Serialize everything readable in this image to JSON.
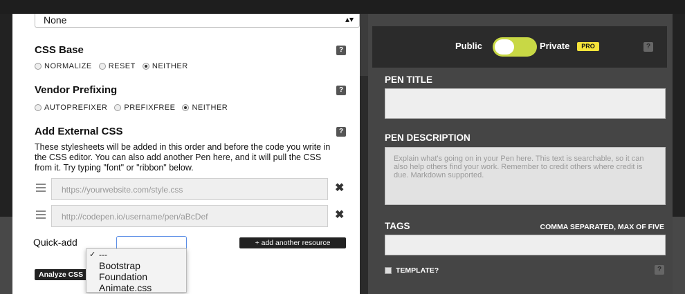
{
  "top_select": {
    "value": "None",
    "arrows": "▴▾"
  },
  "css_base": {
    "title": "CSS Base",
    "help": "?",
    "options": [
      {
        "label": "NORMALIZE",
        "checked": false
      },
      {
        "label": "RESET",
        "checked": false
      },
      {
        "label": "NEITHER",
        "checked": true
      }
    ]
  },
  "vendor_prefixing": {
    "title": "Vendor Prefixing",
    "help": "?",
    "options": [
      {
        "label": "AUTOPREFIXER",
        "checked": false
      },
      {
        "label": "PREFIXFREE",
        "checked": false
      },
      {
        "label": "NEITHER",
        "checked": true
      }
    ]
  },
  "external_css": {
    "title": "Add External CSS",
    "help": "?",
    "description": "These stylesheets will be added in this order and before the code you write in the CSS editor. You can also add another Pen here, and it will pull the CSS from it. Try typing \"font\" or \"ribbon\" below.",
    "resources": [
      {
        "placeholder": "https://yourwebsite.com/style.css",
        "remove": "✖"
      },
      {
        "placeholder": "http://codepen.io/username/pen/aBcDef",
        "remove": "✖"
      }
    ],
    "quick_add_label": "Quick-add",
    "quick_add_options": [
      "---",
      "Bootstrap",
      "Foundation",
      "Animate.css"
    ],
    "quick_add_selected": "---",
    "add_resource_label": "+ add another resource",
    "analyze_label": "Analyze CSS"
  },
  "privacy": {
    "public_label": "Public",
    "private_label": "Private",
    "pro_badge": "PRO",
    "help": "?",
    "toggle_color": "#c8d845"
  },
  "pen_title": {
    "label": "PEN TITLE",
    "value": ""
  },
  "pen_description": {
    "label": "PEN DESCRIPTION",
    "placeholder": "Explain what's going on in your Pen here. This text is searchable, so it can also help others find your work. Remember to credit others where credit is due. Markdown supported."
  },
  "tags": {
    "label": "TAGS",
    "hint": "COMMA SEPARATED, MAX OF FIVE",
    "value": ""
  },
  "template": {
    "label": "TEMPLATE?",
    "help": "?"
  }
}
